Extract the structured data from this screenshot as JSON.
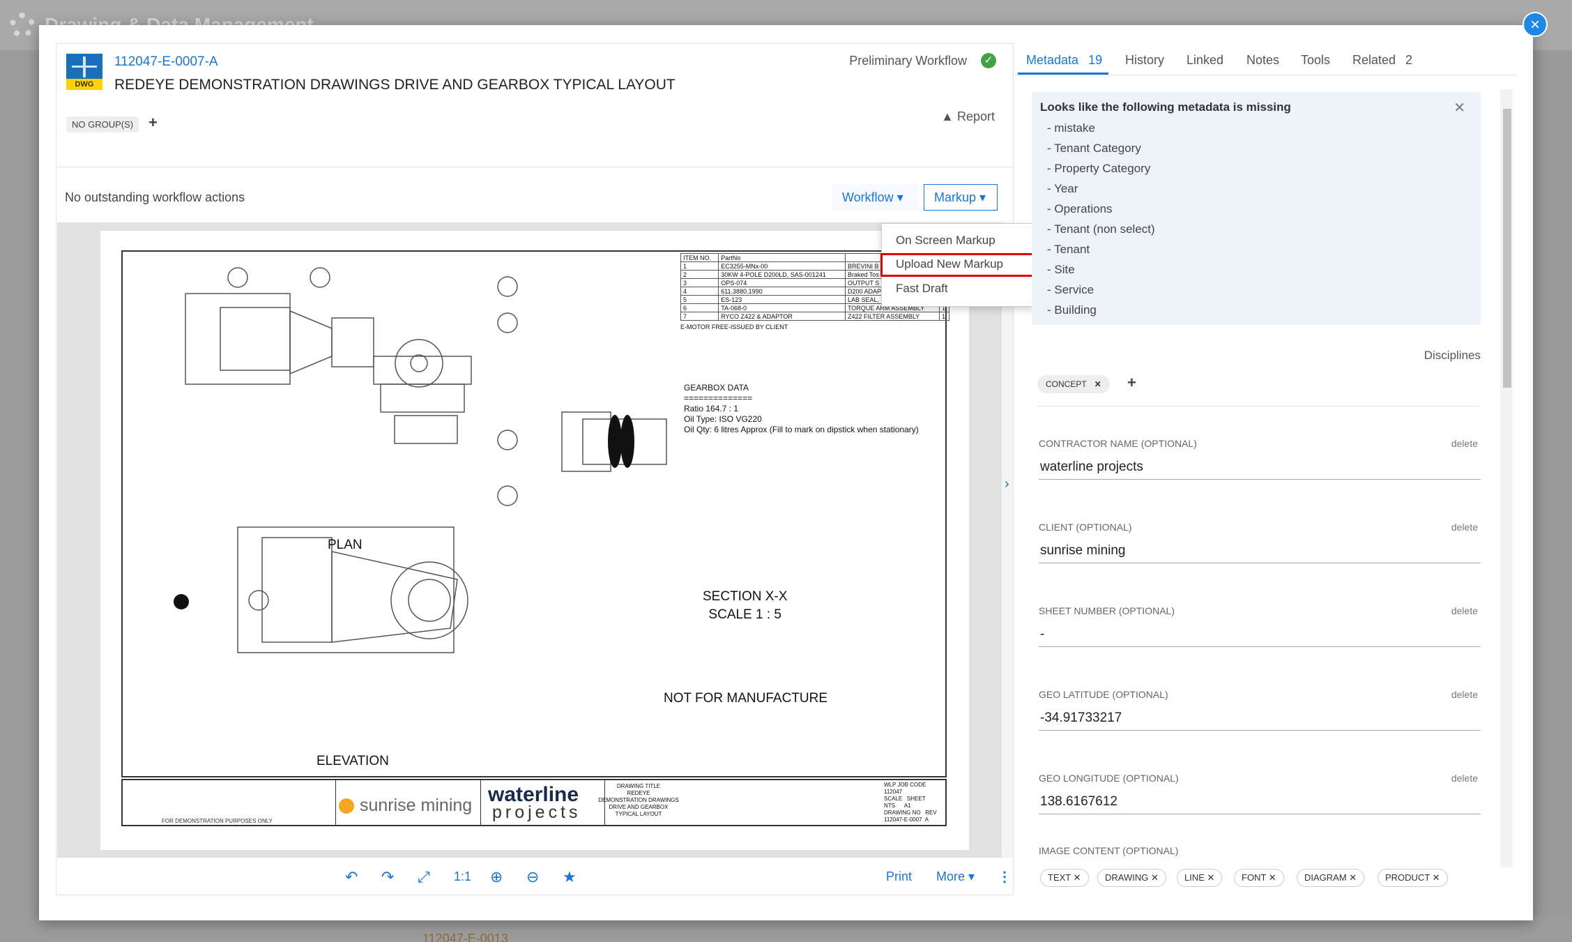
{
  "background": {
    "app_title": "Drawing & Data Management",
    "bottom_doc_number": "112047-E-0013"
  },
  "close_label": "×",
  "document": {
    "number": "112047-E-0007-A",
    "title": "REDEYE DEMONSTRATION DRAWINGS DRIVE AND GEARBOX TYPICAL LAYOUT",
    "file_type": "DWG",
    "workflow_status": "Preliminary Workflow",
    "group_badge": "NO GROUP(S)",
    "report_label": "Report",
    "actions_text": "No outstanding workflow actions",
    "workflow_button": "Workflow",
    "markup_button": "Markup"
  },
  "markup_menu": {
    "items": [
      "On Screen Markup",
      "Upload New Markup",
      "Fast Draft"
    ],
    "highlighted_item": "Upload New Markup"
  },
  "drawing": {
    "plan_label": "PLAN",
    "elevation_label": "ELEVATION",
    "section_label": "SECTION X-X\nSCALE 1 : 5",
    "nfm_label": "NOT FOR MANUFACTURE",
    "gearbox_data": "GEARBOX DATA\n==============\nRatio 164.7 : 1\nOil Type: ISO VG220\nOil Qty: 6 litres Approx (Fill to mark on dipstick when stationary)",
    "parts_header": [
      "ITEM NO.",
      "PartNo",
      "",
      ""
    ],
    "parts_rows": [
      [
        "1",
        "EC3255-MNx-00",
        "BREVINI B",
        ""
      ],
      [
        "2",
        "30KW 4-POLE D200LD, SAS-001241",
        "Braked Tos",
        ""
      ],
      [
        "3",
        "OPS-074",
        "OUTPUT S",
        ""
      ],
      [
        "4",
        "611.3880.1990",
        "D200 ADAP",
        ""
      ],
      [
        "5",
        "ES-123",
        "LAB SEAL, FIXED PART",
        "1"
      ],
      [
        "6",
        "TA-068-0",
        "TORQUE ARM ASSEMBLY",
        "1"
      ],
      [
        "7",
        "RYCO Z422 & ADAPTOR",
        "Z422 FILTER ASSEMBLY",
        "1"
      ]
    ],
    "parts_note": "E-MOTOR FREE-ISSUED BY CLIENT",
    "client_name": "sunrise mining",
    "brand_top": "waterline",
    "brand_bottom": "projects",
    "drawing_title": "DRAWING TITLE\nREDEYE\nDEMONSTRATION DRAWINGS\nDRIVE AND GEARBOX\nTYPICAL LAYOUT",
    "title_codes": "WLP JOB CODE\n112047\nSCALE   SHEET\nNTS      A1\nDRAWING NO   REV\n112047-E-0007  A",
    "demo_note": "FOR DEMONSTRATION PURPOSES ONLY"
  },
  "viewer_toolbar": {
    "rotate_left_icon": "↶",
    "rotate_right_icon": "↷",
    "fit_icon": "⤢",
    "actual_size": "1:1",
    "zoom_in_icon": "⊕",
    "zoom_out_icon": "⊖",
    "star_icon": "★",
    "print_label": "Print",
    "more_label": "More",
    "kebab_icon": "⋮"
  },
  "tabs": [
    {
      "label": "Metadata",
      "count": "19"
    },
    {
      "label": "History",
      "count": ""
    },
    {
      "label": "Linked",
      "count": ""
    },
    {
      "label": "Notes",
      "count": ""
    },
    {
      "label": "Tools",
      "count": ""
    },
    {
      "label": "Related",
      "count": "2"
    }
  ],
  "missing_alert": {
    "title": "Looks like the following metadata is missing",
    "items": [
      "- mistake",
      "- Tenant Category",
      "- Property Category",
      "- Year",
      "- Operations",
      "- Tenant (non select)",
      "- Tenant",
      "- Site",
      "- Service",
      "- Building"
    ]
  },
  "disciplines": {
    "label": "Disciplines",
    "items": [
      "CONCEPT"
    ]
  },
  "fields": [
    {
      "label": "CONTRACTOR NAME (OPTIONAL)",
      "value": "waterline projects",
      "delete": "delete"
    },
    {
      "label": "CLIENT (OPTIONAL)",
      "value": "sunrise mining",
      "delete": "delete"
    },
    {
      "label": "SHEET NUMBER (OPTIONAL)",
      "value": "-",
      "delete": "delete"
    },
    {
      "label": "GEO LATITUDE (OPTIONAL)",
      "value": "-34.91733217",
      "delete": "delete"
    },
    {
      "label": "GEO LONGITUDE (OPTIONAL)",
      "value": "138.6167612",
      "delete": "delete"
    }
  ],
  "image_content": {
    "label": "IMAGE CONTENT (OPTIONAL)",
    "chips": [
      "TEXT",
      "DRAWING",
      "LINE",
      "FONT",
      "DIAGRAM",
      "PRODUCT"
    ]
  },
  "colors": {
    "accent": "#1976d2",
    "highlight": "#e00000",
    "success": "#43a047",
    "alert_bg": "#edf3f9"
  }
}
